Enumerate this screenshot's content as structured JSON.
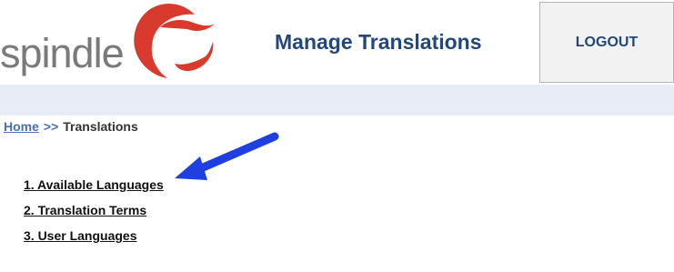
{
  "brand": {
    "logo_text": "spindle",
    "logo_icon": "spindle-swirl-logo"
  },
  "header": {
    "title": "Manage Translations",
    "logout_label": "LOGOUT"
  },
  "breadcrumb": {
    "home": "Home",
    "separator": ">>",
    "current": "Translations"
  },
  "menu": {
    "items": [
      {
        "label": "1. Available Languages"
      },
      {
        "label": "2. Translation Terms"
      },
      {
        "label": "3. User Languages"
      }
    ]
  },
  "annotation": {
    "icon": "blue-arrow-icon",
    "color": "#1f3fe0"
  },
  "colors": {
    "title": "#24477a",
    "link": "#4a6fb5",
    "band": "#e7ecf6",
    "logo_red": "#d83a2e"
  }
}
